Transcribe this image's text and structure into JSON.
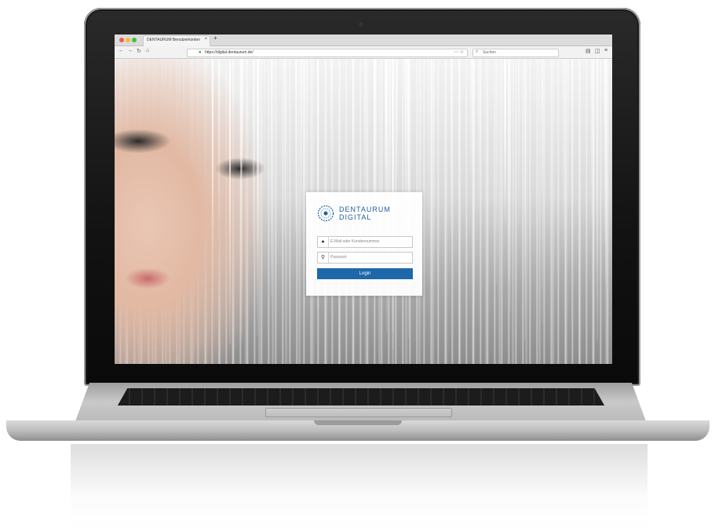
{
  "browser": {
    "tab_title": "DENTAURUM Benutzerkonten",
    "tab_close": "×",
    "new_tab": "+",
    "url": "https://digital.dentaurum.de/",
    "search_placeholder": "Suchen",
    "nav": {
      "back": "←",
      "forward": "→",
      "reload": "↻",
      "home": "⌂"
    }
  },
  "logo": {
    "line1": "DENTAURUM",
    "line2": "DIGITAL"
  },
  "login": {
    "email_placeholder": "E-Mail oder Kundennummer",
    "password_placeholder": "Passwort",
    "button_label": "Login"
  },
  "colors": {
    "brand": "#1d68a8",
    "logo": "#1f5f9d"
  }
}
